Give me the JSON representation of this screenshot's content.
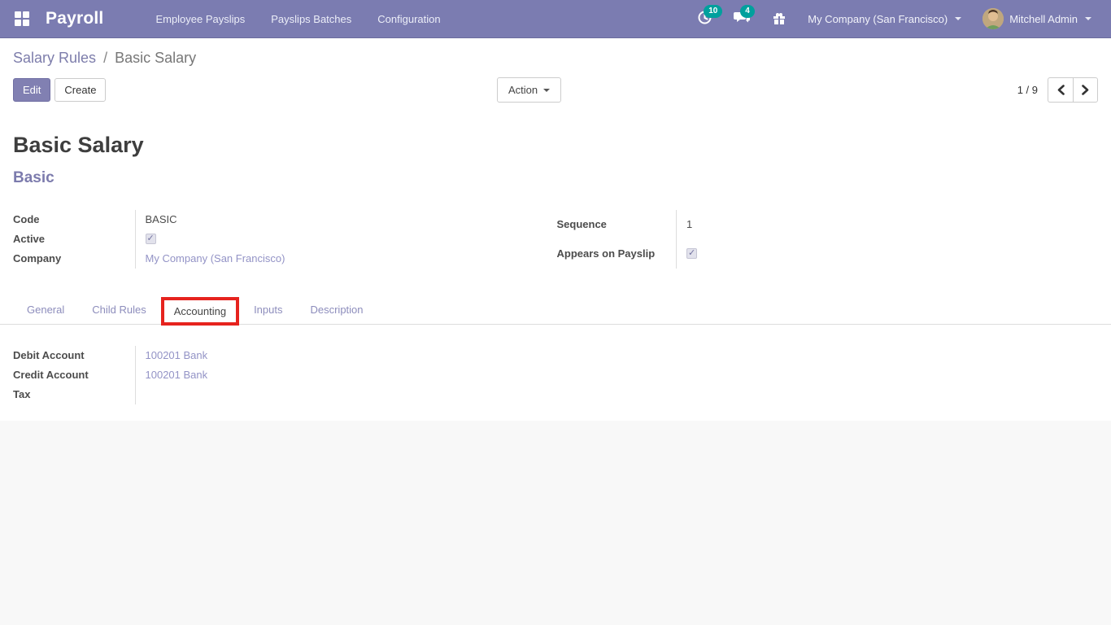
{
  "navbar": {
    "brand": "Payroll",
    "menu": [
      "Employee Payslips",
      "Payslips Batches",
      "Configuration"
    ],
    "systray": {
      "activity_count": "10",
      "message_count": "4",
      "company": "My Company (San Francisco)",
      "user": "Mitchell Admin"
    }
  },
  "control_panel": {
    "breadcrumb": {
      "parent": "Salary Rules",
      "separator": "/",
      "current": "Basic Salary"
    },
    "buttons": {
      "edit": "Edit",
      "create": "Create",
      "action": "Action"
    },
    "pager": {
      "value": "1 / 9"
    }
  },
  "form": {
    "title": "Basic Salary",
    "subtitle": "Basic",
    "fields_left": [
      {
        "label": "Code",
        "value": "BASIC",
        "type": "text"
      },
      {
        "label": "Active",
        "checked": true,
        "type": "checkbox"
      },
      {
        "label": "Company",
        "value": "My Company (San Francisco)",
        "type": "link"
      }
    ],
    "fields_right": [
      {
        "label": "Sequence",
        "value": "1",
        "type": "text"
      },
      {
        "label": "Appears on Payslip",
        "checked": true,
        "type": "checkbox"
      }
    ],
    "tabs": [
      "General",
      "Child Rules",
      "Accounting",
      "Inputs",
      "Description"
    ],
    "active_tab": "Accounting",
    "accounting_fields": [
      {
        "label": "Debit Account",
        "value": "100201 Bank",
        "type": "link"
      },
      {
        "label": "Credit Account",
        "value": "100201 Bank",
        "type": "link"
      },
      {
        "label": "Tax",
        "value": "",
        "type": "text"
      }
    ]
  },
  "colors": {
    "navbar_bg": "#7b7cb1",
    "badge_teal": "#00a09d",
    "link_purple": "#9393c6",
    "breadcrumb_link": "#7d7dab",
    "primary_button": "#8180b2",
    "annotation_red": "#e6231e"
  }
}
